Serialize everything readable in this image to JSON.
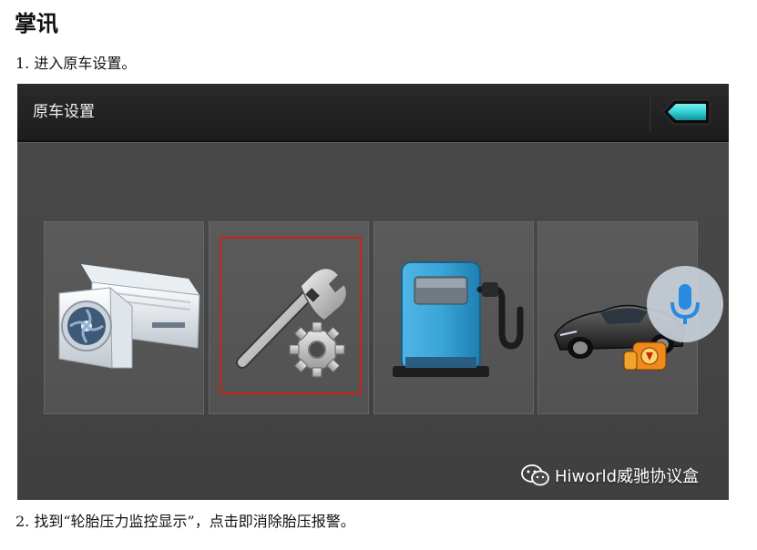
{
  "document": {
    "title": "掌讯",
    "step1": "1. 进入原车设置。",
    "step2": "2. 找到“轮胎压力监控显示”，点击即消除胎压报警。"
  },
  "screen": {
    "header_title": "原车设置",
    "back_icon": "back-arrow-icon",
    "tiles": [
      {
        "icon": "air-conditioner-icon",
        "selected": false
      },
      {
        "icon": "wrench-gear-settings-icon",
        "selected": true
      },
      {
        "icon": "fuel-pump-icon",
        "selected": false
      },
      {
        "icon": "car-oil-warning-icon",
        "selected": false
      }
    ],
    "mic_icon": "microphone-icon",
    "watermark": {
      "icon": "wechat-icon",
      "text": "Hiworld威驰协议盒"
    },
    "colors": {
      "selection_frame": "#c8241e",
      "accent_teal": "#2fd0d4",
      "mic_blue": "#2a8ae0"
    }
  }
}
